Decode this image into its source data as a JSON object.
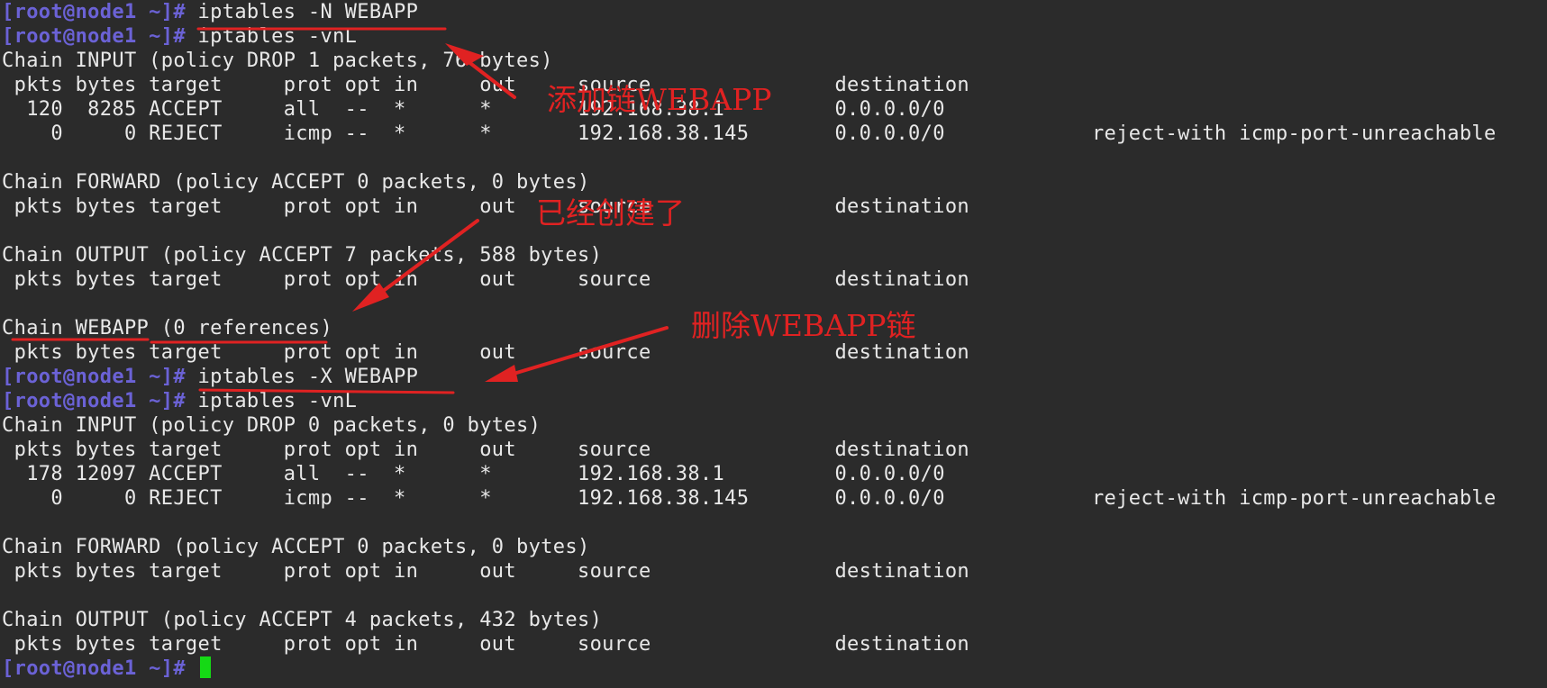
{
  "terminal": {
    "prompt": "[root@node1 ~]#",
    "lines": [
      {
        "prompt": true,
        "text": " iptables -N WEBAPP"
      },
      {
        "prompt": true,
        "text": " iptables -vnL"
      },
      {
        "prompt": false,
        "text": "Chain INPUT (policy DROP 1 packets, 76 bytes)"
      },
      {
        "prompt": false,
        "text": " pkts bytes target     prot opt in     out     source               destination"
      },
      {
        "prompt": false,
        "text": "  120  8285 ACCEPT     all  --  *      *       192.168.38.1         0.0.0.0/0"
      },
      {
        "prompt": false,
        "text": "    0     0 REJECT     icmp --  *      *       192.168.38.145       0.0.0.0/0            reject-with icmp-port-unreachable"
      },
      {
        "prompt": false,
        "text": ""
      },
      {
        "prompt": false,
        "text": "Chain FORWARD (policy ACCEPT 0 packets, 0 bytes)"
      },
      {
        "prompt": false,
        "text": " pkts bytes target     prot opt in     out     source               destination"
      },
      {
        "prompt": false,
        "text": ""
      },
      {
        "prompt": false,
        "text": "Chain OUTPUT (policy ACCEPT 7 packets, 588 bytes)"
      },
      {
        "prompt": false,
        "text": " pkts bytes target     prot opt in     out     source               destination"
      },
      {
        "prompt": false,
        "text": ""
      },
      {
        "prompt": false,
        "text": "Chain WEBAPP (0 references)"
      },
      {
        "prompt": false,
        "text": " pkts bytes target     prot opt in     out     source               destination"
      },
      {
        "prompt": true,
        "text": " iptables -X WEBAPP"
      },
      {
        "prompt": true,
        "text": " iptables -vnL"
      },
      {
        "prompt": false,
        "text": "Chain INPUT (policy DROP 0 packets, 0 bytes)"
      },
      {
        "prompt": false,
        "text": " pkts bytes target     prot opt in     out     source               destination"
      },
      {
        "prompt": false,
        "text": "  178 12097 ACCEPT     all  --  *      *       192.168.38.1         0.0.0.0/0"
      },
      {
        "prompt": false,
        "text": "    0     0 REJECT     icmp --  *      *       192.168.38.145       0.0.0.0/0            reject-with icmp-port-unreachable"
      },
      {
        "prompt": false,
        "text": ""
      },
      {
        "prompt": false,
        "text": "Chain FORWARD (policy ACCEPT 0 packets, 0 bytes)"
      },
      {
        "prompt": false,
        "text": " pkts bytes target     prot opt in     out     source               destination"
      },
      {
        "prompt": false,
        "text": ""
      },
      {
        "prompt": false,
        "text": "Chain OUTPUT (policy ACCEPT 4 packets, 432 bytes)"
      },
      {
        "prompt": false,
        "text": " pkts bytes target     prot opt in     out     source               destination"
      },
      {
        "prompt": true,
        "text": " ",
        "cursor": true
      }
    ]
  },
  "annotations": {
    "add_chain": "添加链WEBAPP",
    "already_created": "已经创建了",
    "delete_chain": "删除WEBAPP链"
  },
  "colors": {
    "background": "#2b2b2b",
    "text": "#e8e8e8",
    "prompt": "#6b62d6",
    "cursor": "#15d915",
    "annotation": "#e02222"
  }
}
